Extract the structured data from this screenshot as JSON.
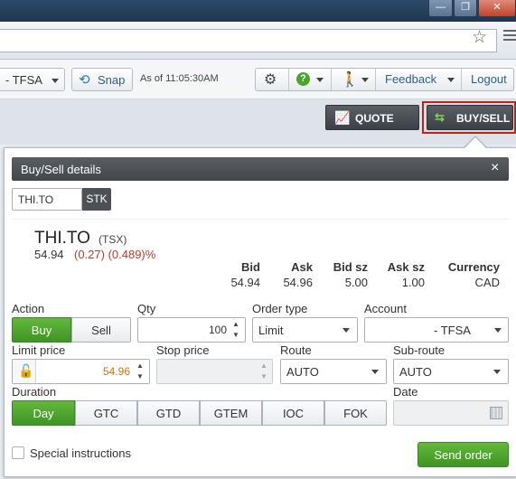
{
  "window": {
    "min_glyph": "—",
    "max_glyph": "❐",
    "close_glyph": "✕"
  },
  "toolbar": {
    "account_selected": "- TFSA",
    "snap_label": "Snap",
    "as_of": "As of 11:05:30AM",
    "feedback_label": "Feedback",
    "logout_label": "Logout"
  },
  "actions": {
    "quote_label": "QUOTE",
    "buysell_label": "BUY/SELL"
  },
  "panel": {
    "title": "Buy/Sell details",
    "close_glyph": "×",
    "symbol_value": "THI.TO",
    "symbol_type": "STK",
    "quote": {
      "symbol": "THI.TO",
      "exchange": "(TSX)",
      "last": "54.94",
      "change": "(0.27) (0.489)%",
      "headers": [
        "Bid",
        "Ask",
        "Bid sz",
        "Ask sz",
        "Currency"
      ],
      "values": [
        "54.94",
        "54.96",
        "5.00",
        "1.00",
        "CAD"
      ]
    },
    "form": {
      "action_label": "Action",
      "buy_label": "Buy",
      "sell_label": "Sell",
      "qty_label": "Qty",
      "qty_value": "100",
      "order_type_label": "Order type",
      "order_type_value": "Limit",
      "account_label": "Account",
      "account_value": "- TFSA",
      "limit_price_label": "Limit price",
      "limit_price_value": "54.96",
      "stop_price_label": "Stop price",
      "stop_price_value": "",
      "route_label": "Route",
      "route_value": "AUTO",
      "subroute_label": "Sub-route",
      "subroute_value": "AUTO",
      "duration_label": "Duration",
      "durations": [
        "Day",
        "GTC",
        "GTD",
        "GTEM",
        "IOC",
        "FOK"
      ],
      "date_label": "Date",
      "date_value": "",
      "special_label": "Special instructions",
      "send_label": "Send order"
    }
  },
  "colors": {
    "accent_green": "#4aa52c",
    "change_red": "#c0392b",
    "limit_price_orange": "#c97a00",
    "highlight_border": "#c0221a"
  }
}
